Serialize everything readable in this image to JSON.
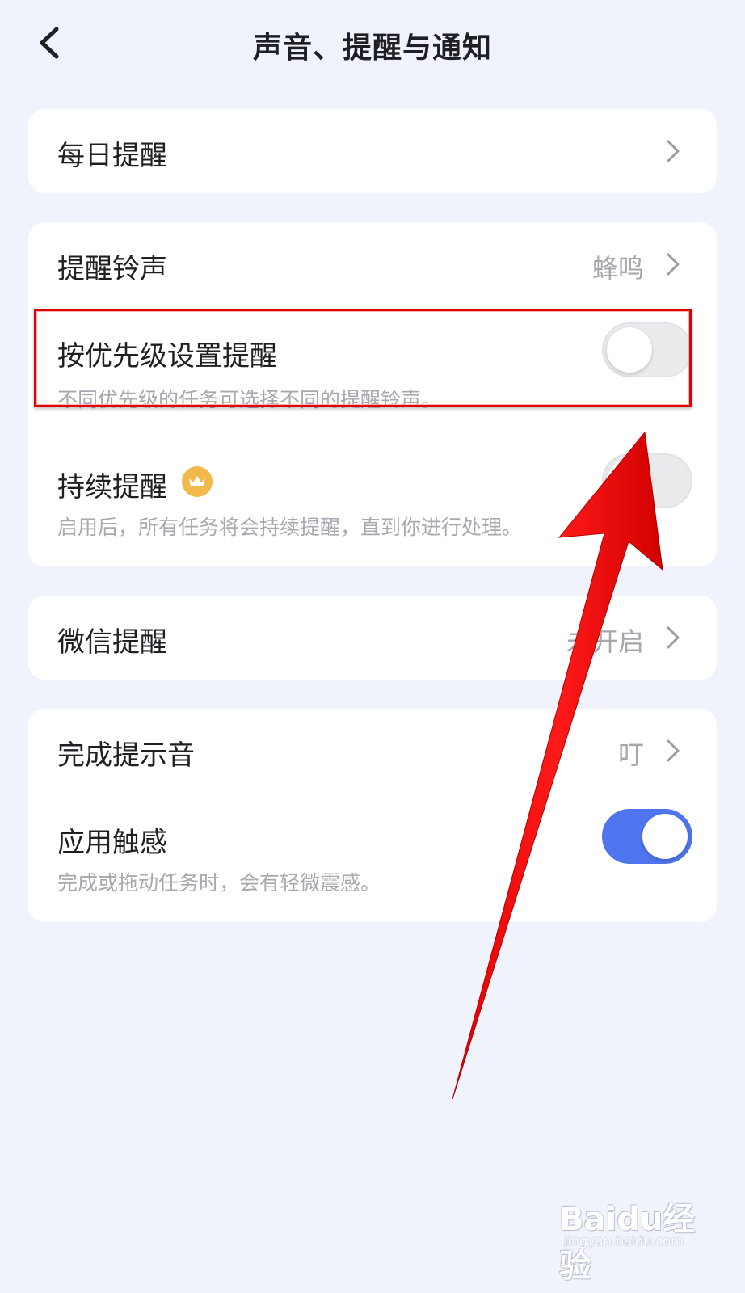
{
  "header": {
    "title": "声音、提醒与通知"
  },
  "card1": {
    "daily": {
      "label": "每日提醒"
    }
  },
  "card2": {
    "ringtone": {
      "label": "提醒铃声",
      "value": "蜂鸣"
    },
    "priority": {
      "label": "按优先级设置提醒",
      "desc": "不同优先级的任务可选择不同的提醒铃声。",
      "enabled": false
    },
    "continuous": {
      "label": "持续提醒",
      "desc": "启用后，所有任务将会持续提醒，直到你进行处理。",
      "enabled": false,
      "badge_icon": "crown-icon"
    }
  },
  "card3": {
    "wechat": {
      "label": "微信提醒",
      "value": "未开启"
    }
  },
  "card4": {
    "complete_sound": {
      "label": "完成提示音",
      "value": "叮"
    },
    "haptics": {
      "label": "应用触感",
      "desc": "完成或拖动任务时，会有轻微震感。",
      "enabled": true
    }
  },
  "watermark": {
    "logo": "Baidu经验",
    "url": "jingyan.baidu.com"
  },
  "colors": {
    "background": "#f0f3fc",
    "toggle_on": "#4e74ee",
    "annotation": "#e00000",
    "crown": "#f1b94a"
  }
}
